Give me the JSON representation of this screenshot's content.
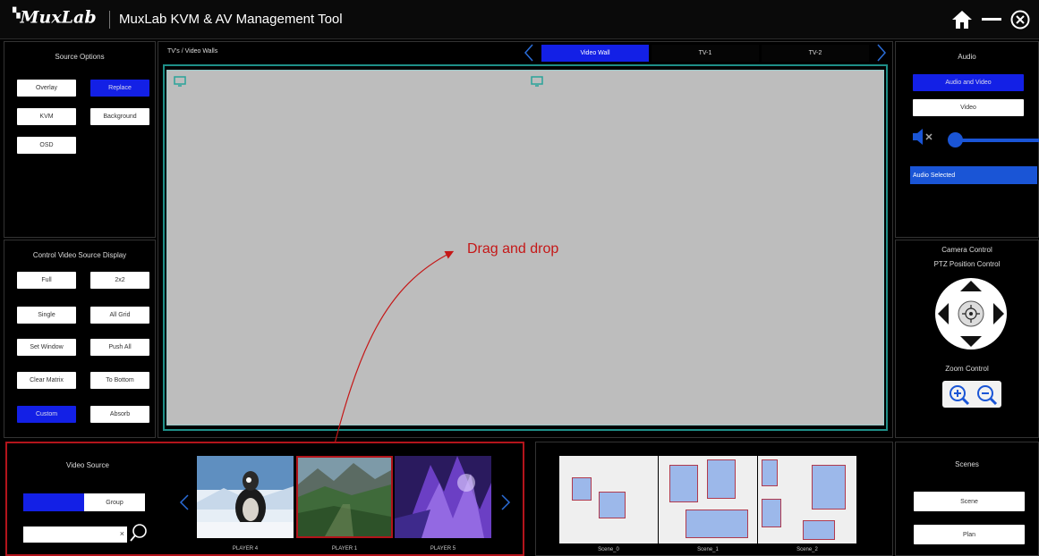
{
  "app": {
    "logo": "MuxLab",
    "title": "MuxLab KVM & AV Management Tool"
  },
  "source_options": {
    "title": "Source Options",
    "buttons": [
      "Overlay",
      "Replace",
      "KVM",
      "Background",
      "OSD"
    ]
  },
  "control_display": {
    "title": "Control Video Source Display",
    "buttons": [
      "Full",
      "2x2",
      "Single",
      "All Grid",
      "Set Window",
      "Push All",
      "Clear Matrix",
      "To Bottom",
      "Custom",
      "Absorb"
    ]
  },
  "tvs": {
    "title": "TV's / Video Walls",
    "tabs": [
      "Video Wall",
      "TV-1",
      "TV-2"
    ]
  },
  "annotation": {
    "text": "Drag and drop",
    "color": "#c51717"
  },
  "audio": {
    "title": "Audio",
    "buttons": [
      "Audio and Video",
      "Video"
    ],
    "selected_label": "Audio Selected",
    "volume_level": 0.06
  },
  "camera": {
    "title": "Camera Control",
    "ptz_label": "PTZ Position Control",
    "zoom_label": "Zoom Control"
  },
  "video_source": {
    "title": "Video Source",
    "tab_group": "Group",
    "search_clear": "×",
    "players": [
      "PLAYER 4",
      "PLAYER 1",
      "PLAYER 5"
    ]
  },
  "scenes_panel": {
    "title": "Scenes",
    "scenes": [
      "Scene_0",
      "Scene_1",
      "Scene_2"
    ],
    "buttons": [
      "Scene",
      "Plan"
    ]
  },
  "colors": {
    "accent_blue": "#1320e6",
    "teal_frame": "#1e8f88",
    "highlight_red": "#b3141b"
  }
}
